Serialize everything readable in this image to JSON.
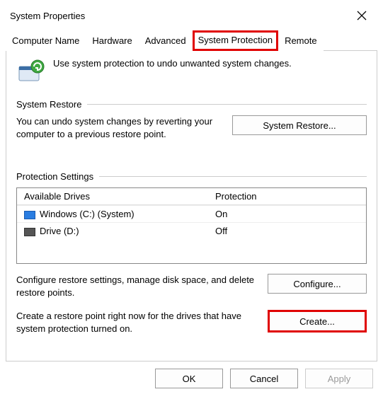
{
  "window": {
    "title": "System Properties"
  },
  "tabs": {
    "computer_name": "Computer Name",
    "hardware": "Hardware",
    "advanced": "Advanced",
    "system_protection": "System Protection",
    "remote": "Remote"
  },
  "intro": "Use system protection to undo unwanted system changes.",
  "restore": {
    "heading": "System Restore",
    "text": "You can undo system changes by reverting your computer to a previous restore point.",
    "button": "System Restore..."
  },
  "protection": {
    "heading": "Protection Settings",
    "col_drives": "Available Drives",
    "col_protection": "Protection",
    "rows": [
      {
        "name": "Windows (C:) (System)",
        "status": "On"
      },
      {
        "name": "Drive (D:)",
        "status": "Off"
      }
    ],
    "configure_text": "Configure restore settings, manage disk space, and delete restore points.",
    "configure_button": "Configure...",
    "create_text": "Create a restore point right now for the drives that have system protection turned on.",
    "create_button": "Create..."
  },
  "footer": {
    "ok": "OK",
    "cancel": "Cancel",
    "apply": "Apply"
  }
}
